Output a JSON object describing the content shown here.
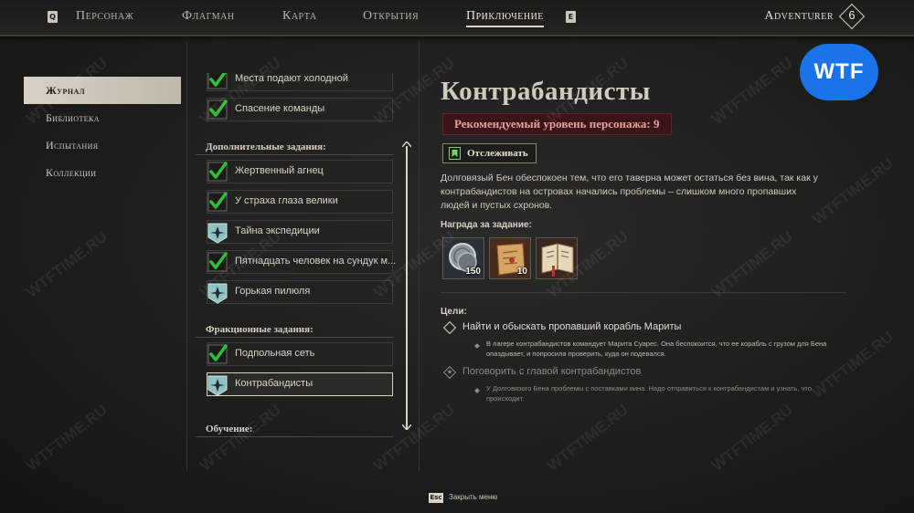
{
  "nav": {
    "key_left": "Q",
    "key_right": "E",
    "tabs": [
      {
        "label": "Персонаж"
      },
      {
        "label": "Флагман"
      },
      {
        "label": "Карта"
      },
      {
        "label": "Открытия"
      },
      {
        "label": "Приключение"
      }
    ],
    "active_tab": "Приключение",
    "player_name": "Adventurer",
    "player_level": "6"
  },
  "left_menu": {
    "items": [
      {
        "label": "Журнал"
      },
      {
        "label": "Библиотека"
      },
      {
        "label": "Испытания"
      },
      {
        "label": "Коллекции"
      }
    ],
    "active": "Журнал"
  },
  "quest_list": {
    "top_partial": [
      {
        "label": "Места подают холодной",
        "status": "completed"
      },
      {
        "label": "Спасение команды",
        "status": "completed"
      }
    ],
    "side_header": "Дополнительные задания:",
    "side_quests": [
      {
        "label": "Жертвенный агнец",
        "status": "completed"
      },
      {
        "label": "У страха глаза велики",
        "status": "completed"
      },
      {
        "label": "Тайна экспедиции",
        "status": "active"
      },
      {
        "label": "Пятнадцать человек на сундук м...",
        "status": "completed"
      },
      {
        "label": "Горькая пилюля",
        "status": "active"
      }
    ],
    "faction_header": "Фракционные задания:",
    "faction_quests": [
      {
        "label": "Подпольная сеть",
        "status": "completed"
      },
      {
        "label": "Контрабандисты",
        "status": "active",
        "selected": true
      }
    ],
    "training_header": "Обучение:"
  },
  "detail": {
    "title": "Контрабандисты",
    "recommended_level": "Рекомендуемый уровень персонажа: 9",
    "track_button": "Отслеживать",
    "description": "Долговязый Бен обеспокоен тем, что его таверна может остаться без вина, так как у контрабандистов на островах начались проблемы – слишком много пропавших людей и пустых схронов.",
    "reward_title": "Награда за задание:",
    "rewards": [
      {
        "icon": "silver-coin-icon",
        "count": "150"
      },
      {
        "icon": "map-scroll-icon",
        "count": "10"
      },
      {
        "icon": "book-icon",
        "count": ""
      }
    ],
    "goals_title": "Цели:",
    "goals": [
      {
        "label": "Найти и обыскать пропавший корабль Мариты",
        "note": "В лагере контрабандистов командует Марита Суарес. Она беспокоится, что ее корабль с грузом для Бена опаздывает, и попросила проверить, куда он подевался.",
        "state": "current"
      },
      {
        "label": "Поговорить с главой контрабандистов",
        "note": "У Долговязого Бена проблемы с поставками вина. Надо отправиться к контрабандистам и узнать, что происходит.",
        "state": "pending"
      }
    ]
  },
  "footer": {
    "key": "Esc",
    "label": "Закрыть меню"
  },
  "badge": {
    "text": "WTF",
    "color": "#1a73e8"
  },
  "watermark": "WTFTIME.RU",
  "colors": {
    "background": "#1c1d1b",
    "active_menu": "#d7d2c4",
    "recommended_bg": "#3a1417",
    "recommended_text": "#e6a1a1",
    "check_green": "#2fbf3a"
  }
}
